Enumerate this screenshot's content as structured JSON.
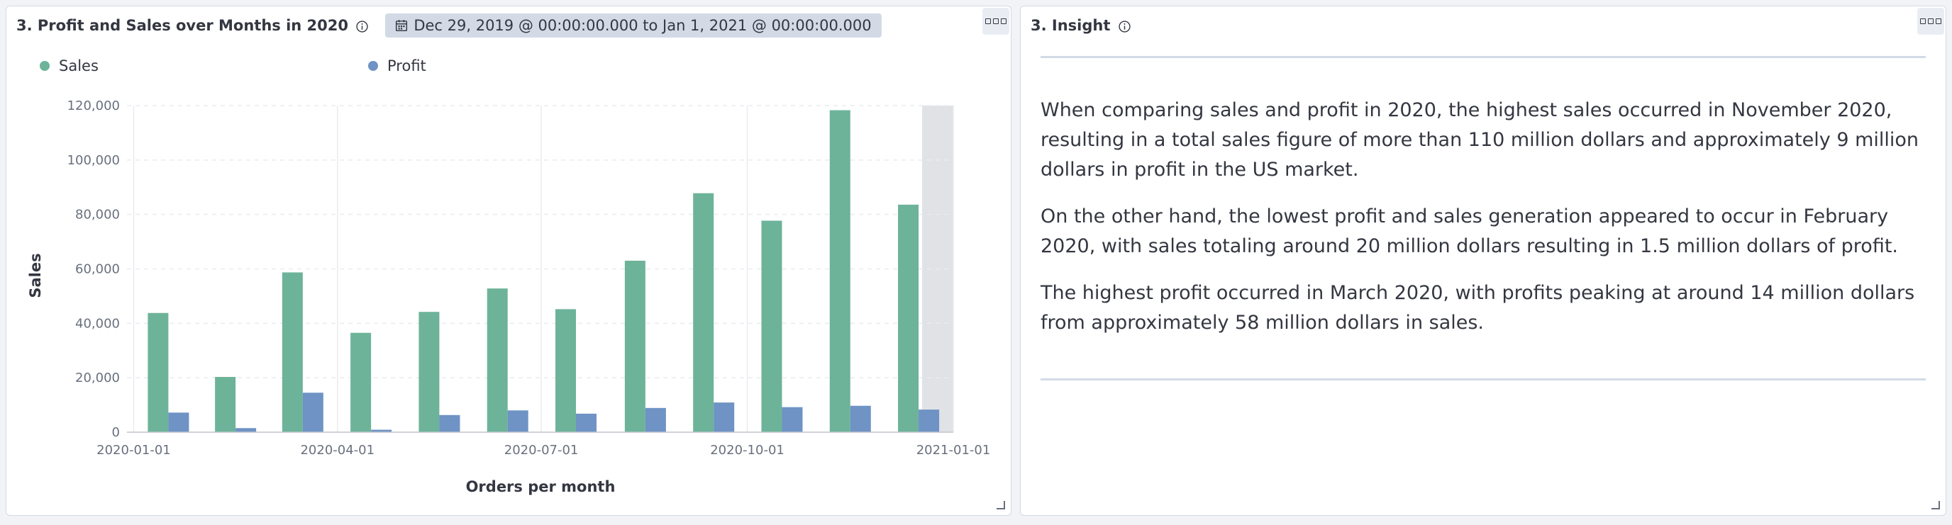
{
  "chart_panel": {
    "title": "3. Profit and Sales over Months in 2020",
    "time_range": "Dec 29, 2019 @ 00:00:00.000 to Jan 1, 2021 @ 00:00:00.000"
  },
  "insight_panel": {
    "title": "3. Insight",
    "paragraphs": [
      "When comparing sales and profit in 2020, the highest sales occurred in November 2020, resulting in a total sales figure of more than 110 million dollars and approximately 9 million dollars in profit in the US market.",
      "On the other hand, the lowest profit and sales generation appeared to occur in February 2020, with sales totaling around 20 million dollars resulting in 1.5 million dollars of profit.",
      "The highest profit occurred in March 2020, with profits peaking at around 14 million dollars from approximately 58 million dollars in sales."
    ]
  },
  "colors": {
    "sales": "#6db39a",
    "profit": "#6e93c4",
    "out_of_range": "#e0e2e6",
    "grid": "#e9ebef"
  },
  "chart_data": {
    "type": "bar",
    "categories": [
      "2020-01",
      "2020-02",
      "2020-03",
      "2020-04",
      "2020-05",
      "2020-06",
      "2020-07",
      "2020-08",
      "2020-09",
      "2020-10",
      "2020-11",
      "2020-12"
    ],
    "series": [
      {
        "name": "Sales",
        "values": [
          43800,
          20300,
          58700,
          36500,
          44200,
          52800,
          45200,
          63000,
          87800,
          77700,
          118300,
          83600
        ]
      },
      {
        "name": "Profit",
        "values": [
          7200,
          1500,
          14500,
          900,
          6300,
          8000,
          6800,
          8900,
          10900,
          9200,
          9700,
          8300
        ]
      }
    ],
    "x_ticks": [
      "2020-01-01",
      "2020-04-01",
      "2020-07-01",
      "2020-10-01",
      "2021-01-01"
    ],
    "y_ticks": [
      "0",
      "20,000",
      "40,000",
      "60,000",
      "80,000",
      "100,000",
      "120,000"
    ],
    "ylim": [
      0,
      120000
    ],
    "xlabel": "Orders per month",
    "ylabel": "Sales",
    "grid": true,
    "legend_position": "top"
  }
}
